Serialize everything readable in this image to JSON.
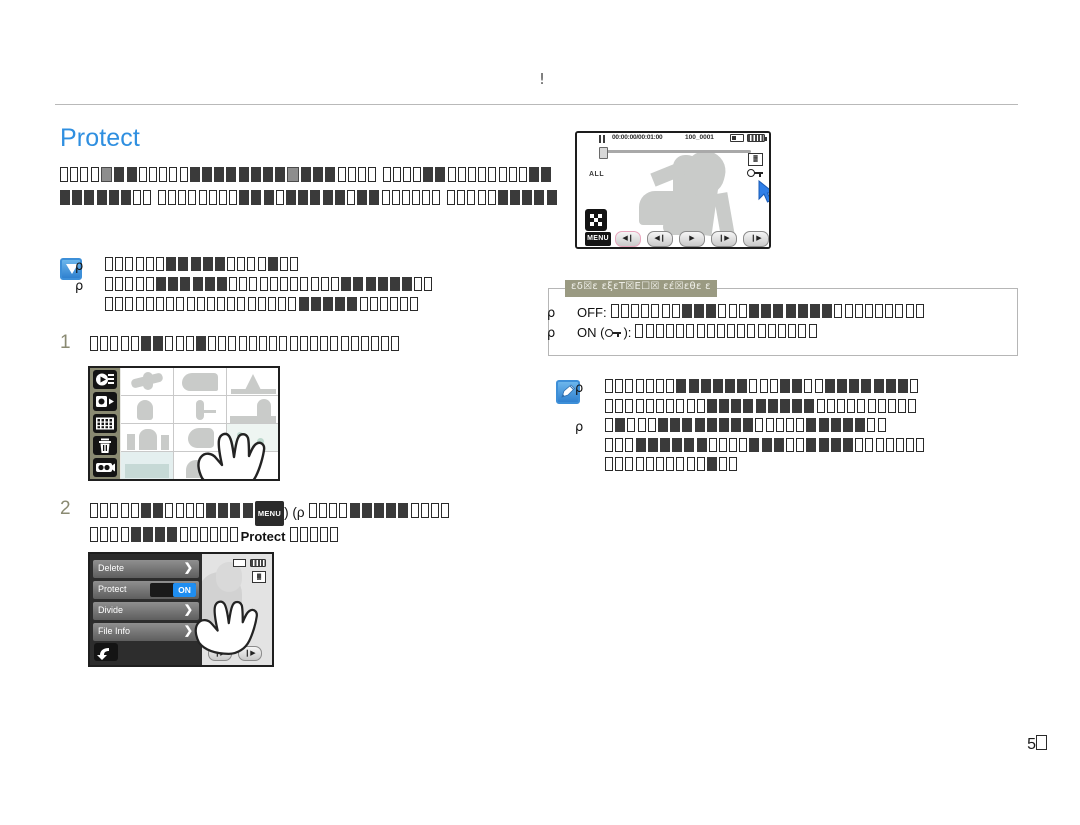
{
  "header": {
    "mark": "!"
  },
  "title": "Protect",
  "page_number": {
    "digits": "5",
    "has_tofu_glyph": true
  },
  "body_copy": {
    "script": "tofu",
    "lines": [
      {
        "glyphs": [
          1,
          1,
          1,
          1,
          3,
          2,
          2,
          1,
          1,
          1,
          1,
          1,
          2,
          2,
          2,
          2,
          2,
          2,
          2,
          2,
          3,
          2,
          2,
          2,
          1,
          1,
          1,
          1
        ]
      },
      {
        "glyphs": [
          1,
          1,
          1,
          1,
          2,
          2,
          1,
          1,
          1,
          1,
          1,
          1,
          1,
          1,
          2,
          2,
          2,
          2,
          2,
          2,
          2,
          2,
          1,
          1
        ]
      },
      {
        "glyphs": [
          1,
          1,
          1,
          1,
          1,
          1,
          1,
          1,
          2,
          2,
          2,
          1,
          2,
          2,
          2,
          2,
          2,
          1,
          2,
          2,
          1,
          1,
          1,
          1,
          1,
          1
        ]
      },
      {
        "glyphs": [
          1,
          1,
          1,
          1,
          1,
          2,
          2,
          2,
          2,
          2
        ]
      }
    ]
  },
  "check_note": {
    "icon": "check-mark-icon",
    "bullets": [
      {
        "marker": "ρ",
        "glyphs": [
          1,
          1,
          1,
          1,
          1,
          1,
          2,
          2,
          2,
          2,
          2,
          1,
          1,
          1,
          1,
          2,
          1,
          1
        ]
      },
      {
        "marker": "ρ",
        "glyphs": [
          1,
          1,
          1,
          1,
          1,
          2,
          2,
          2,
          2,
          2,
          2,
          1,
          1,
          1,
          1,
          1,
          1,
          1,
          1,
          1,
          1,
          1,
          2,
          2,
          2,
          2,
          2,
          2,
          1,
          1
        ]
      },
      {
        "marker": "",
        "glyphs": [
          1,
          1,
          1,
          1,
          1,
          1,
          1,
          1,
          1,
          1,
          1,
          1,
          1,
          1,
          1,
          1,
          1,
          1,
          1,
          2,
          2,
          2,
          2,
          2,
          1,
          1,
          1,
          1,
          1,
          1
        ]
      }
    ]
  },
  "steps": [
    {
      "number": "1",
      "glyphs": [
        1,
        1,
        1,
        1,
        1,
        2,
        2,
        1,
        1,
        1,
        2,
        1,
        1,
        1,
        1,
        1,
        1,
        1,
        1,
        1,
        1,
        1,
        1,
        1,
        1,
        1,
        1,
        1,
        1,
        1
      ]
    },
    {
      "number": "2",
      "line1_pre": [
        1,
        1,
        1,
        1,
        1,
        2,
        2,
        1,
        1,
        1,
        1,
        2,
        2,
        2,
        2
      ],
      "inline_badge": "MENU",
      "after_badge": ") (ρ",
      "line1_post": [
        1,
        1,
        1,
        1,
        2,
        2,
        2,
        2,
        2,
        1,
        1,
        1,
        1
      ],
      "line2_pre": [
        1,
        1,
        1,
        1,
        2,
        2,
        2,
        2,
        1,
        1,
        1,
        1,
        1,
        1
      ],
      "highlight_word": "Protect",
      "line2_post": [
        1,
        1,
        1,
        1,
        1
      ]
    }
  ],
  "lcd_screen": {
    "name": "playback-screen",
    "timecode": "00:00:00/00:01:00",
    "file_number": "100_0001",
    "all_label": "ALL",
    "menu_button": "MENU",
    "icons": [
      "pause-icon",
      "battery-icon",
      "memory-card-icon",
      "protect-key-icon",
      "quality-icon",
      "thumbnail-grid-icon",
      "pointer-cursor-icon"
    ],
    "playback_buttons": [
      {
        "name": "reverse-skip-button",
        "glyph": "◀❙",
        "selected": true
      },
      {
        "name": "previous-frame-button",
        "glyph": "◀❙",
        "selected": false
      },
      {
        "name": "play-button",
        "glyph": "▶",
        "selected": false
      },
      {
        "name": "next-frame-button",
        "glyph": "❙▶",
        "selected": false
      },
      {
        "name": "forward-skip-button",
        "glyph": "❙▶",
        "selected": false
      }
    ]
  },
  "grid_screen": {
    "name": "thumbnail-grid-screen",
    "sidebar_icons": [
      "video-playback-icon",
      "photo-playback-icon",
      "calendar-grid-icon",
      "trash-icon",
      "camera-record-icon"
    ],
    "thumbnail_count": 12,
    "pointer": "hand-tap-icon"
  },
  "menu_screen": {
    "name": "file-option-menu",
    "rows": [
      {
        "label": "Delete",
        "control": "arrow"
      },
      {
        "label": "Protect",
        "control": "toggle",
        "toggle_value": "ON"
      },
      {
        "label": "Divide",
        "control": "arrow"
      },
      {
        "label": "File Info",
        "control": "arrow"
      }
    ],
    "back_button": "back-arrow-icon",
    "pointer": "hand-tap-icon",
    "playback_buttons": [
      {
        "glyph": "❙▶"
      },
      {
        "glyph": "❙▶"
      }
    ]
  },
  "callout": {
    "tag": "εδ☒ε εξεΤ☒Ε☐☒ εέ☒εθε ε",
    "options": [
      {
        "label": "OFF:",
        "has_key_icon": false,
        "glyphs": [
          1,
          1,
          1,
          1,
          1,
          1,
          1,
          2,
          2,
          2,
          1,
          1,
          1,
          2,
          2,
          2,
          2,
          2,
          2,
          2,
          1,
          1,
          1,
          1,
          1,
          1,
          1,
          1,
          1
        ]
      },
      {
        "label": "ON",
        "has_key_icon": true,
        "suffix": ":",
        "glyphs": [
          1,
          1,
          1,
          1,
          1,
          1,
          1,
          1,
          1,
          1,
          1,
          1,
          1,
          1,
          1,
          1,
          1,
          1
        ]
      }
    ]
  },
  "pen_note": {
    "icon": "pencil-note-icon",
    "bullets": [
      {
        "marker": "ρ",
        "glyphs": [
          1,
          1,
          1,
          1,
          1,
          1,
          1,
          2,
          2,
          2,
          2,
          2,
          2,
          1,
          1,
          1,
          2,
          2,
          1,
          1,
          2,
          2,
          2,
          2,
          2,
          2,
          2,
          1
        ]
      },
      {
        "marker": "",
        "glyphs": [
          1,
          1,
          1,
          1,
          1,
          1,
          1,
          1,
          1,
          1,
          2,
          2,
          2,
          2,
          2,
          2,
          2,
          2,
          2,
          1,
          1,
          1,
          1,
          1,
          1,
          1,
          1,
          1,
          1
        ]
      },
      {
        "marker": "ρ",
        "glyphs": [
          1,
          2,
          1,
          1,
          1,
          2,
          2,
          2,
          2,
          2,
          2,
          2,
          2,
          1,
          1,
          1,
          1,
          1,
          2,
          2,
          2,
          2,
          2,
          1,
          1
        ]
      },
      {
        "marker": "",
        "glyphs": [
          1,
          1,
          1,
          2,
          2,
          2,
          2,
          2,
          2,
          1,
          1,
          1,
          1,
          2,
          2,
          2,
          1,
          1,
          2,
          2,
          2,
          2,
          1,
          1,
          1,
          1,
          1,
          1,
          1
        ]
      },
      {
        "marker": "",
        "glyphs": [
          1,
          1,
          1,
          1,
          1,
          1,
          1,
          1,
          1,
          1,
          2,
          1,
          1
        ]
      }
    ]
  }
}
